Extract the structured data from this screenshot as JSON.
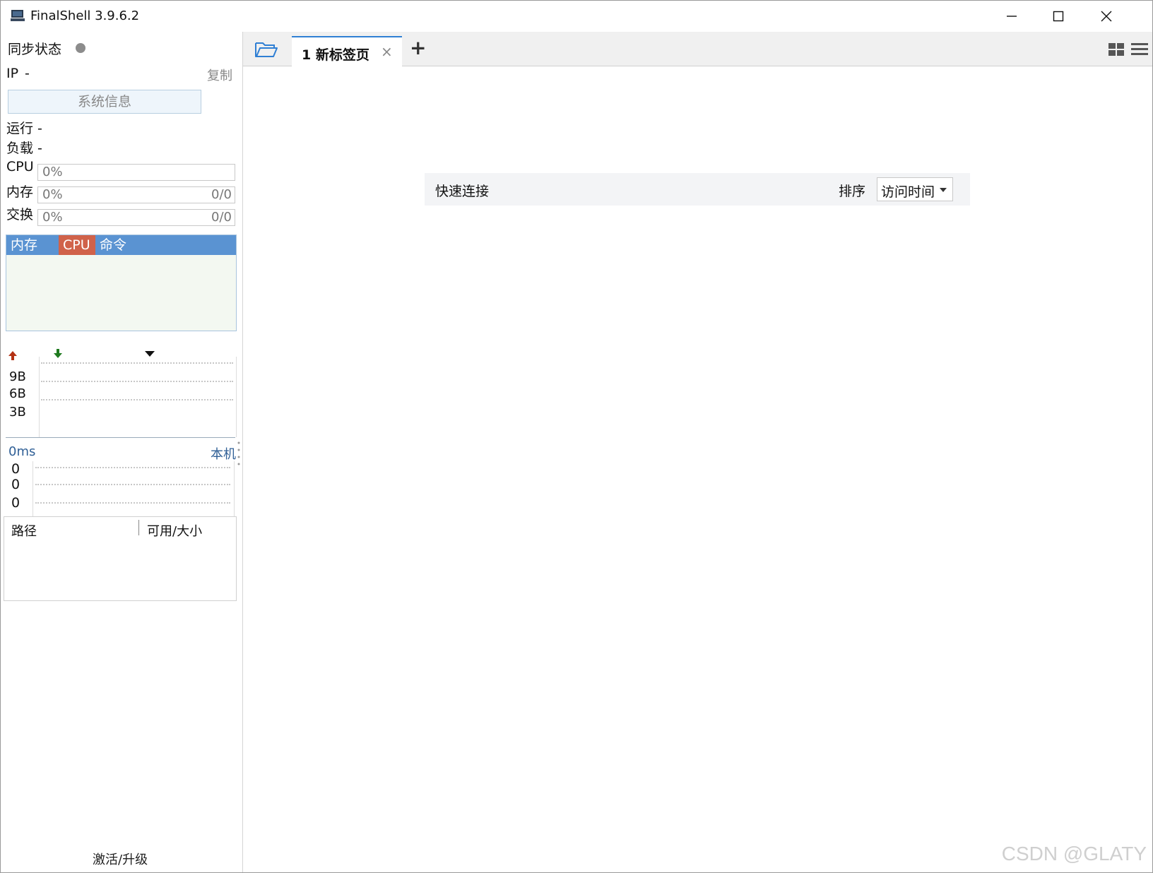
{
  "window": {
    "title": "FinalShell 3.9.6.2"
  },
  "sidebar": {
    "sync_label": "同步状态",
    "ip_label": "IP",
    "ip_value": "-",
    "copy_label": "复制",
    "sysinfo_button": "系统信息",
    "uptime_label": "运行 -",
    "load_label": "负载 -",
    "cpu": {
      "label": "CPU",
      "percent": "0%"
    },
    "memory": {
      "label": "内存",
      "percent": "0%",
      "value": "0/0"
    },
    "swap": {
      "label": "交换",
      "percent": "0%",
      "value": "0/0"
    },
    "process_tabs": [
      "内存",
      "CPU",
      "命令"
    ],
    "network": {
      "ticks": [
        "9B",
        "6B",
        "3B"
      ]
    },
    "ping": {
      "latency": "0ms",
      "target": "本机",
      "ticks": [
        "0",
        "0",
        "0"
      ]
    },
    "disk_headers": [
      "路径",
      "可用/大小"
    ],
    "activate_label": "激活/升级"
  },
  "tabs": [
    {
      "label": "1 新标签页"
    }
  ],
  "quick_connect": {
    "label": "快速连接",
    "sort_label": "排序",
    "sort_value": "访问时间"
  },
  "watermark": "CSDN @GLATY",
  "colors": {
    "accent": "#2f7fd4",
    "process_header": "#5a93d2",
    "cpu_tab": "#d0624a",
    "upload_arrow": "#b43214",
    "download_arrow": "#1f7a1f"
  }
}
